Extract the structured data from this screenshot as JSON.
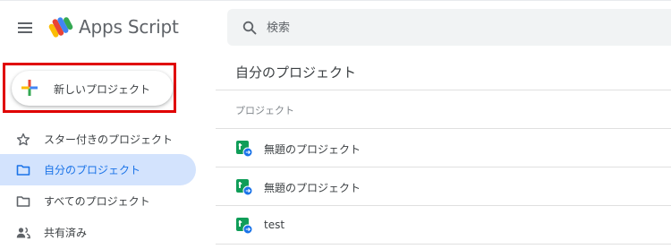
{
  "header": {
    "app_title": "Apps Script",
    "search_placeholder": "検索"
  },
  "new_project": {
    "label": "新しいプロジェクト"
  },
  "sidebar": {
    "items": [
      {
        "label": "スター付きのプロジェクト",
        "icon": "star-icon",
        "active": false
      },
      {
        "label": "自分のプロジェクト",
        "icon": "folder-icon",
        "active": true
      },
      {
        "label": "すべてのプロジェクト",
        "icon": "folder-icon",
        "active": false
      },
      {
        "label": "共有済み",
        "icon": "people-icon",
        "active": false
      }
    ]
  },
  "main": {
    "title": "自分のプロジェクト",
    "column_header": "プロジェクト",
    "rows": [
      {
        "name": "無題のプロジェクト",
        "icon": "apps-script-project-icon"
      },
      {
        "name": "無題のプロジェクト",
        "icon": "apps-script-project-icon"
      },
      {
        "name": "test",
        "icon": "apps-script-project-icon"
      }
    ]
  },
  "colors": {
    "accent": "#1a73e8",
    "active_nav_bg": "#d3e3fd",
    "highlight_box": "#e00000",
    "search_bg": "#f1f3f4"
  }
}
